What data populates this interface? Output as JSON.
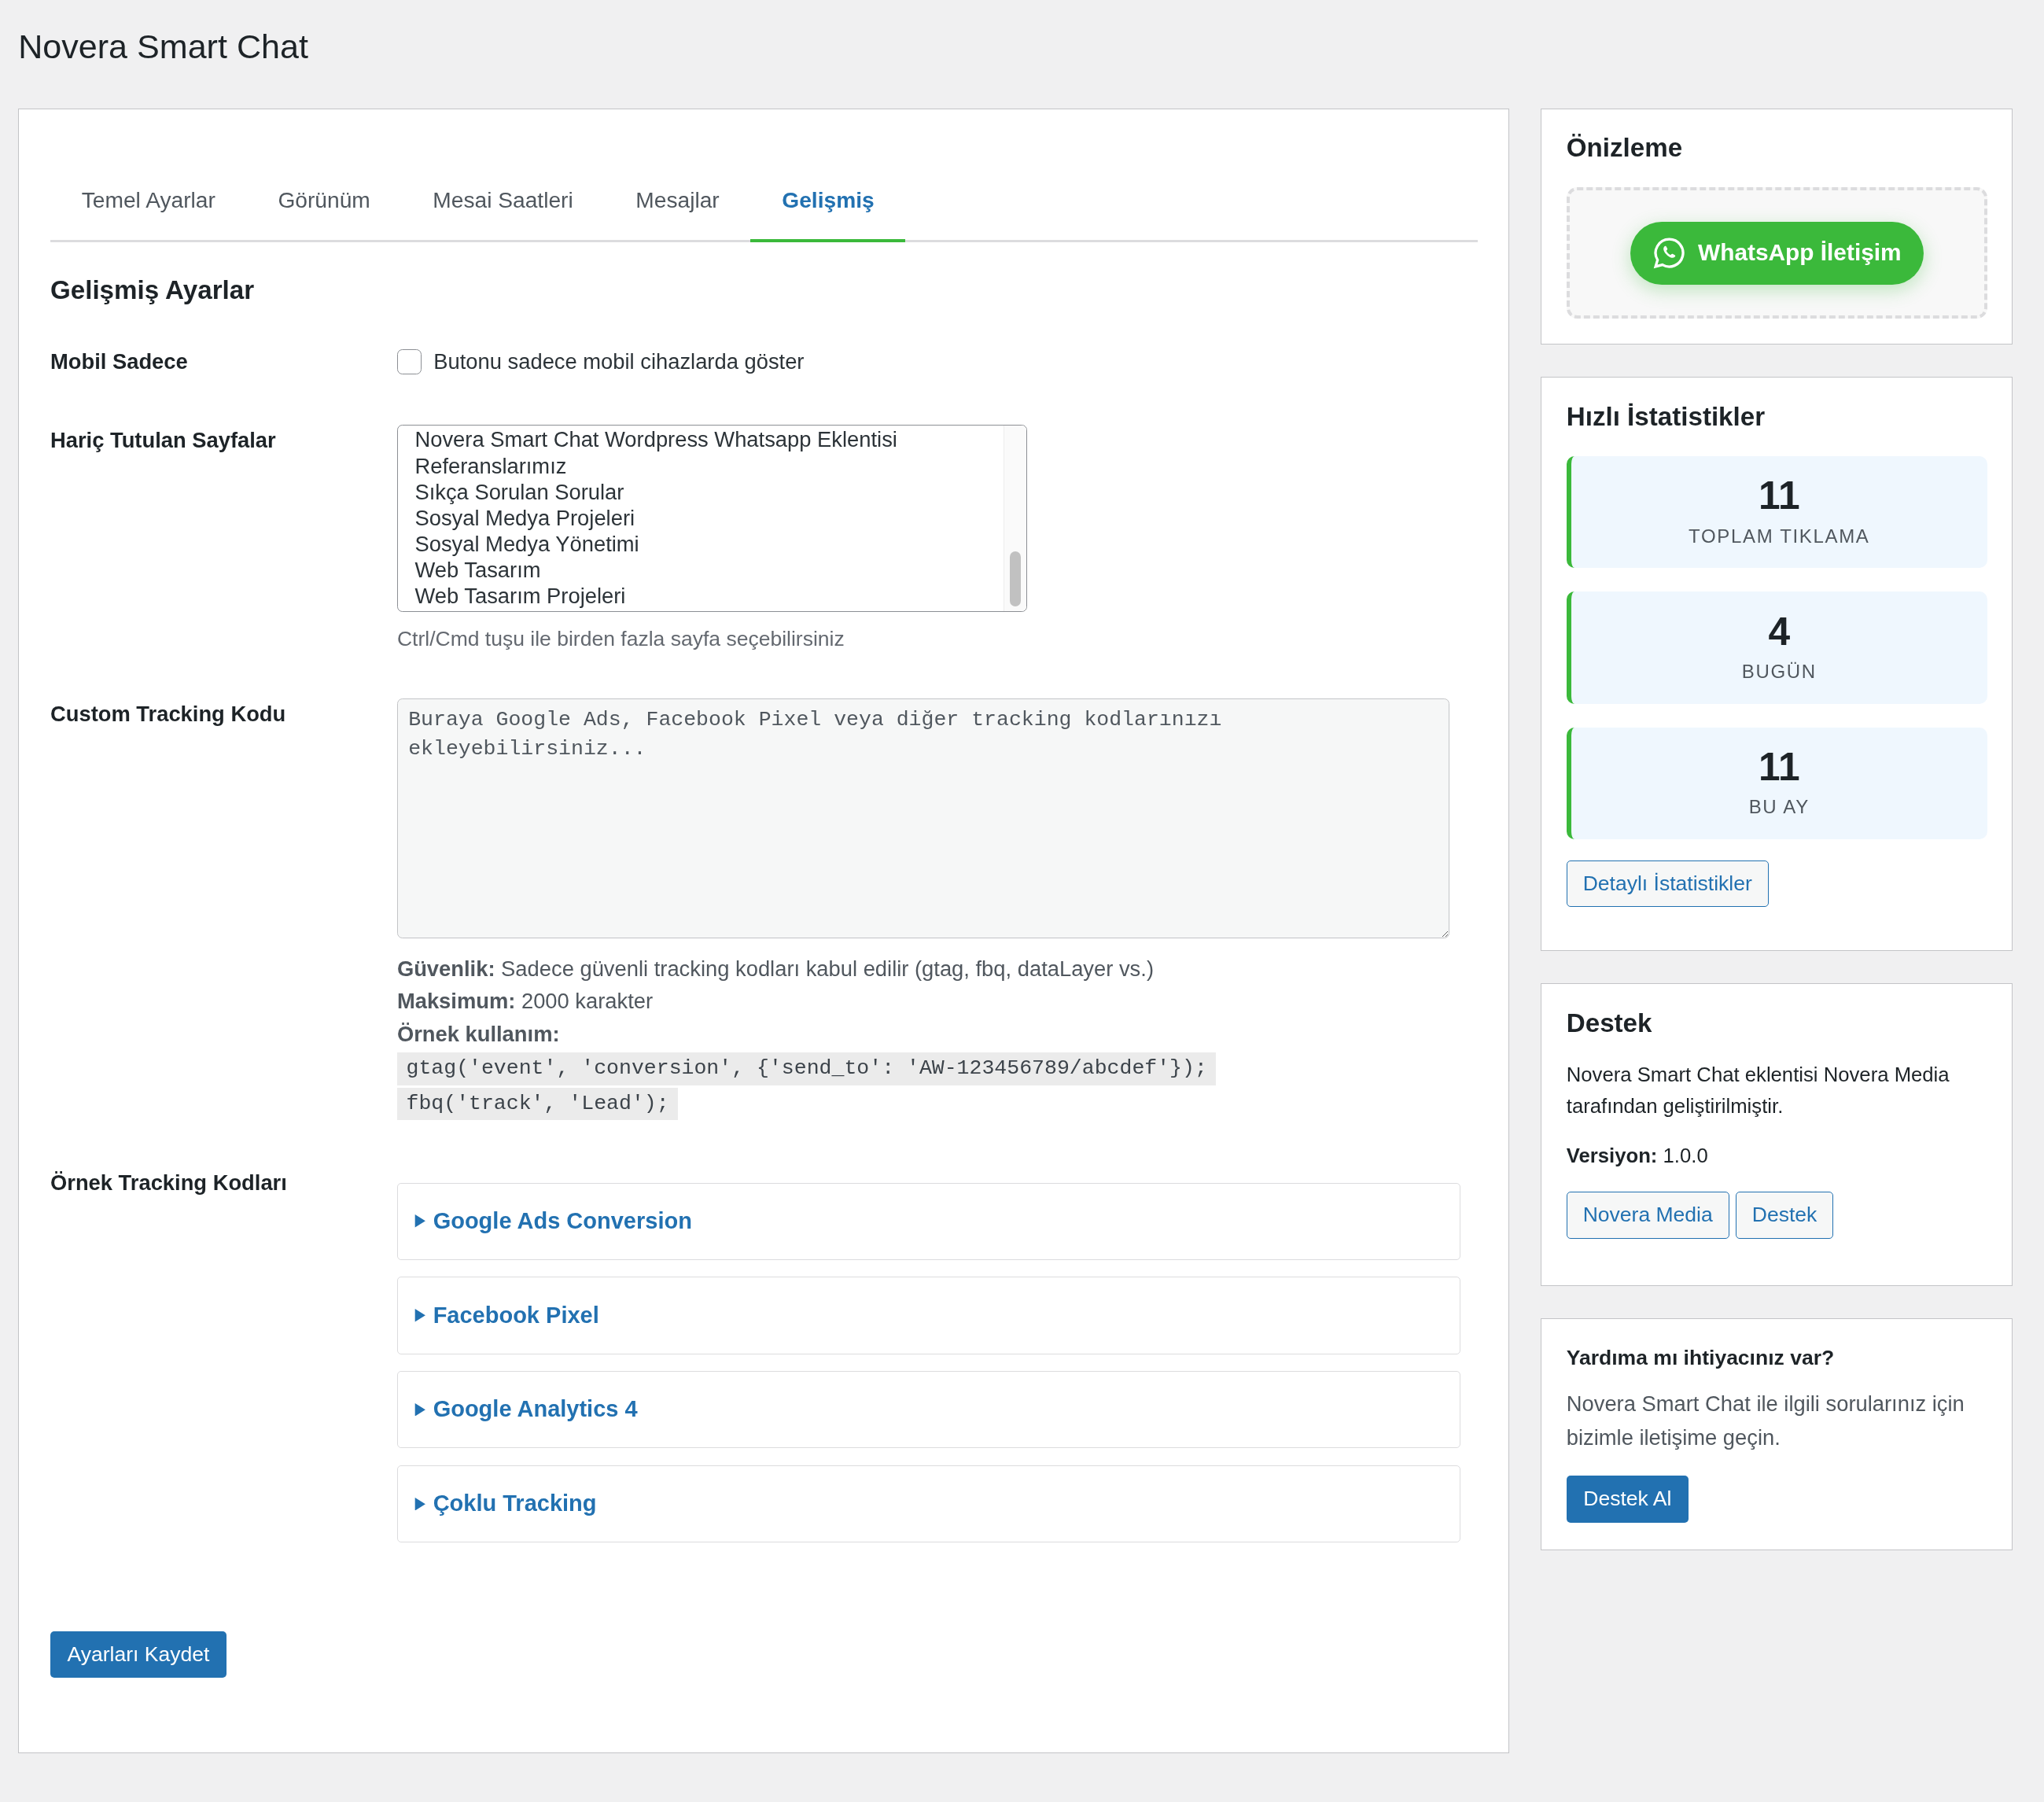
{
  "page_title": "Novera Smart Chat",
  "tabs": [
    {
      "label": "Temel Ayarlar",
      "selected": false
    },
    {
      "label": "Görünüm",
      "selected": false
    },
    {
      "label": "Mesai Saatleri",
      "selected": false
    },
    {
      "label": "Mesajlar",
      "selected": false
    },
    {
      "label": "Gelişmiş",
      "selected": true
    }
  ],
  "section_title": "Gelişmiş Ayarlar",
  "mobile_only": {
    "label": "Mobil Sadece",
    "checkbox_label": "Butonu sadece mobil cihazlarda göster",
    "checked": false
  },
  "excluded_pages": {
    "label": "Hariç Tutulan Sayfalar",
    "options": [
      {
        "text": "Novera Smart Chat Wordpress Whatsapp Eklentisi",
        "selected": false
      },
      {
        "text": "Referanslarımız",
        "selected": false
      },
      {
        "text": "Sıkça Sorulan Sorular",
        "selected": false
      },
      {
        "text": "Sosyal Medya Projeleri",
        "selected": false
      },
      {
        "text": "Sosyal Medya Yönetimi",
        "selected": false
      },
      {
        "text": "Web Tasarım",
        "selected": false
      },
      {
        "text": "Web Tasarım Projeleri",
        "selected": false
      }
    ],
    "hint": "Ctrl/Cmd tuşu ile birden fazla sayfa seçebilirsiniz"
  },
  "custom_tracking": {
    "label": "Custom Tracking Kodu",
    "placeholder": "Buraya Google Ads, Facebook Pixel veya diğer tracking kodlarınızı ekleyebilirsiniz...",
    "notes": [
      "**Güvenlik:** Sadece güvenli tracking kodları kabul edilir (gtag, fbq, dataLayer vs.)",
      "**Maksimum:** 2000 karakter",
      "**Örnek kullanım:**"
    ],
    "code_lines": [
      "gtag('event', 'conversion', {'send_to': 'AW-123456789/abcdef'});",
      "fbq('track', 'Lead');"
    ]
  },
  "example_codes": {
    "label": "Örnek Tracking Kodları",
    "items": [
      {
        "title": "Google Ads Conversion",
        "expanded": false
      },
      {
        "title": "Facebook Pixel",
        "expanded": false
      },
      {
        "title": "Google Analytics 4",
        "expanded": false
      },
      {
        "title": "Çoklu Tracking",
        "expanded": false
      }
    ]
  },
  "save_button": "Ayarları Kaydet",
  "sidebar": {
    "preview": {
      "title": "Önizleme",
      "button": "WhatsApp İletişim"
    },
    "stats": {
      "title": "Hızlı İstatistikler",
      "items": [
        {
          "value": "11",
          "label": "TOPLAM TIKLAMA"
        },
        {
          "value": "4",
          "label": "BUGÜN"
        },
        {
          "value": "11",
          "label": "BU AY"
        }
      ],
      "button": "Detaylı İstatistikler"
    },
    "support": {
      "title": "Destek",
      "text": "Novera Smart Chat eklentisi Novera Media tarafından geliştirilmiştir.",
      "version": "**Versiyon:** 1.0.0",
      "buttons": [
        "Novera Media",
        "Destek"
      ]
    },
    "help": {
      "title": "Yardıma mı ihtiyacınız var?",
      "text": "Novera Smart Chat ile ilgili sorularınız için bizimle iletişime geçin.",
      "button": "Destek Al"
    }
  }
}
